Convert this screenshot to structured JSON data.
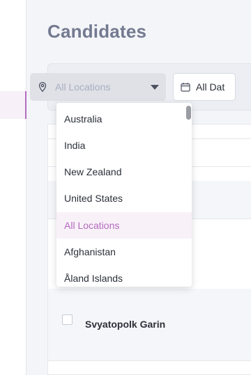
{
  "page": {
    "title": "Candidates"
  },
  "filters": {
    "location_placeholder": "All Locations",
    "date_label": "All Dat"
  },
  "location_dropdown": {
    "items": [
      "Australia",
      "India",
      "New Zealand",
      "United States",
      "All Locations",
      "Afghanistan",
      "Åland Islands"
    ],
    "selected": "All Locations"
  },
  "table": {
    "rows": [
      {
        "name": "Svyatopolk Garin"
      }
    ]
  },
  "colors": {
    "accent": "#b46bbf",
    "title": "#737a91"
  },
  "icons": {
    "location": "location-pin-icon",
    "date": "calendar-icon",
    "caret": "caret-down-icon"
  }
}
